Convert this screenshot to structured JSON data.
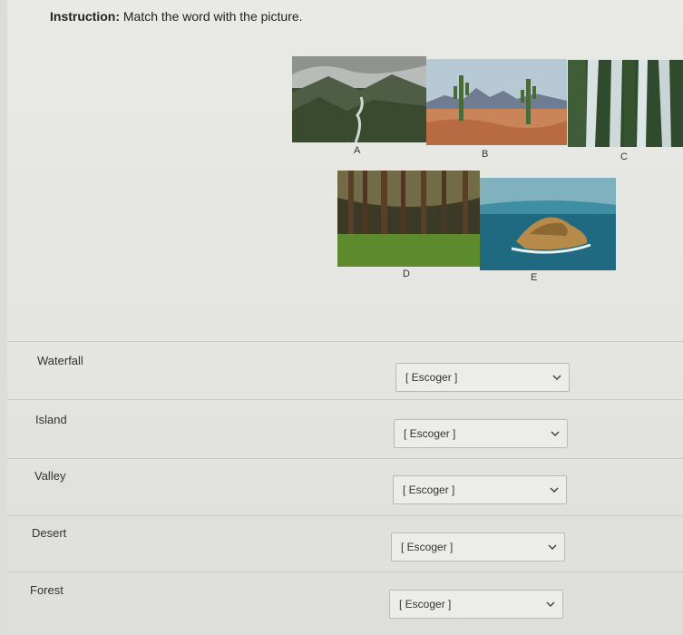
{
  "instruction": {
    "prefix": "Instruction:",
    "text": "Match the word with the picture."
  },
  "images": [
    {
      "caption": "A"
    },
    {
      "caption": "B"
    },
    {
      "caption": "C"
    },
    {
      "caption": "D"
    },
    {
      "caption": "E"
    }
  ],
  "rows": [
    {
      "word": "Waterfall",
      "selected": "[ Escoger ]"
    },
    {
      "word": "Island",
      "selected": "[ Escoger ]"
    },
    {
      "word": "Valley",
      "selected": "[ Escoger ]"
    },
    {
      "word": "Desert",
      "selected": "[ Escoger ]"
    },
    {
      "word": "Forest",
      "selected": "[ Escoger ]"
    }
  ],
  "icons": {
    "select_arrow": "chevron-down-icon"
  }
}
